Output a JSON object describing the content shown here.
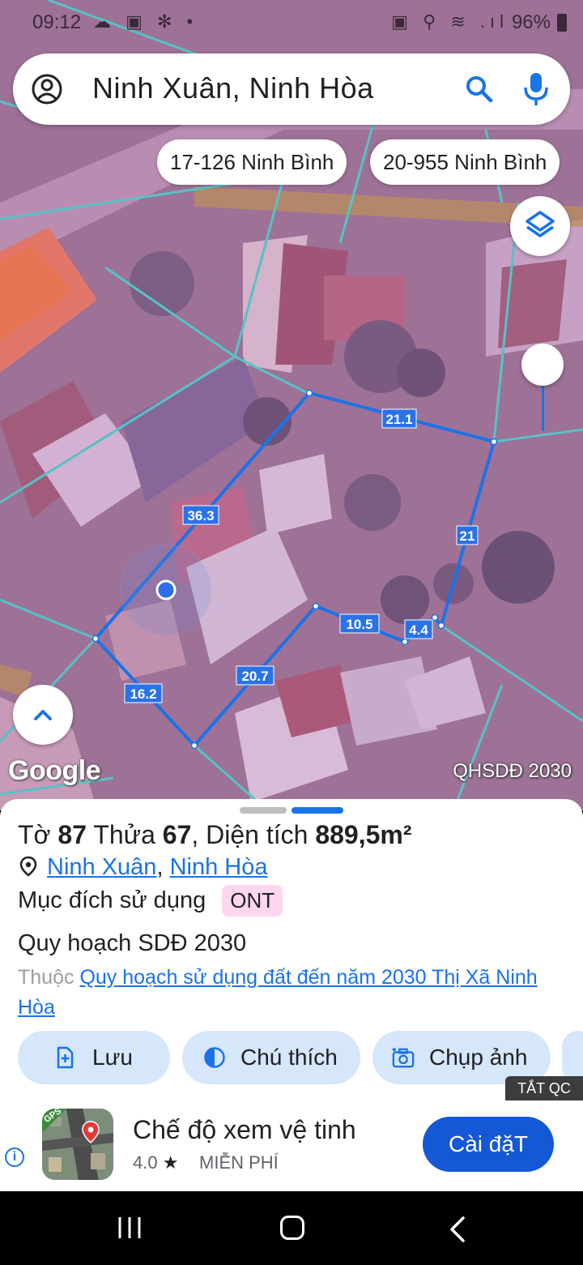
{
  "status_bar": {
    "time": "09:12",
    "left_icons": "☁ ▣ ✻ •",
    "right_icons": "▣ ⚲ ≋ .ıl",
    "battery": "96%"
  },
  "search": {
    "query": "Ninh Xuân, Ninh Hòa",
    "icons": [
      "account-icon",
      "search-icon",
      "mic-icon"
    ]
  },
  "suggestion_chips": [
    "17-126 Ninh Bình",
    "20-955 Ninh Bình"
  ],
  "map": {
    "edge_labels": [
      "21.1",
      "21",
      "36.3",
      "10.5",
      "4.4",
      "20.7",
      "16.2"
    ],
    "google_logo": "Google",
    "plan_label": "QHSDĐ 2030",
    "colors": {
      "parcel_line": "#1a73e8",
      "boundary_line": "#3fd8c8",
      "overlay": "#c060c0"
    }
  },
  "sheet": {
    "title_to_label": "Tờ",
    "title_to_value": "87",
    "title_thua_label": "Thửa",
    "title_thua_value": "67",
    "title_area_label": ", Diện tích",
    "title_area_value": "889,5m²",
    "location_part1": "Ninh Xuân",
    "location_sep": ",",
    "location_part2": "Ninh Hòa",
    "purpose_label": "Mục đích sử dụng",
    "purpose_code": "ONT",
    "plan_title": "Quy hoạch SDĐ 2030",
    "belongs_prefix": "Thuộc",
    "belongs_link": "Quy hoạch sử dụng đất đến năm 2030 Thị Xã Ninh Hòa",
    "actions": [
      {
        "label": "Lưu",
        "icon": "add-bookmark-icon"
      },
      {
        "label": "Chú thích",
        "icon": "contrast-icon"
      },
      {
        "label": "Chụp ảnh",
        "icon": "camera-icon"
      }
    ]
  },
  "ad": {
    "tag": "TẮT QC",
    "app_name": "Chế độ xem vệ tinh",
    "rating": "4.0",
    "price": "MIỄN PHÍ",
    "install_label": "Cài đặT",
    "icon_text": "GPS"
  }
}
